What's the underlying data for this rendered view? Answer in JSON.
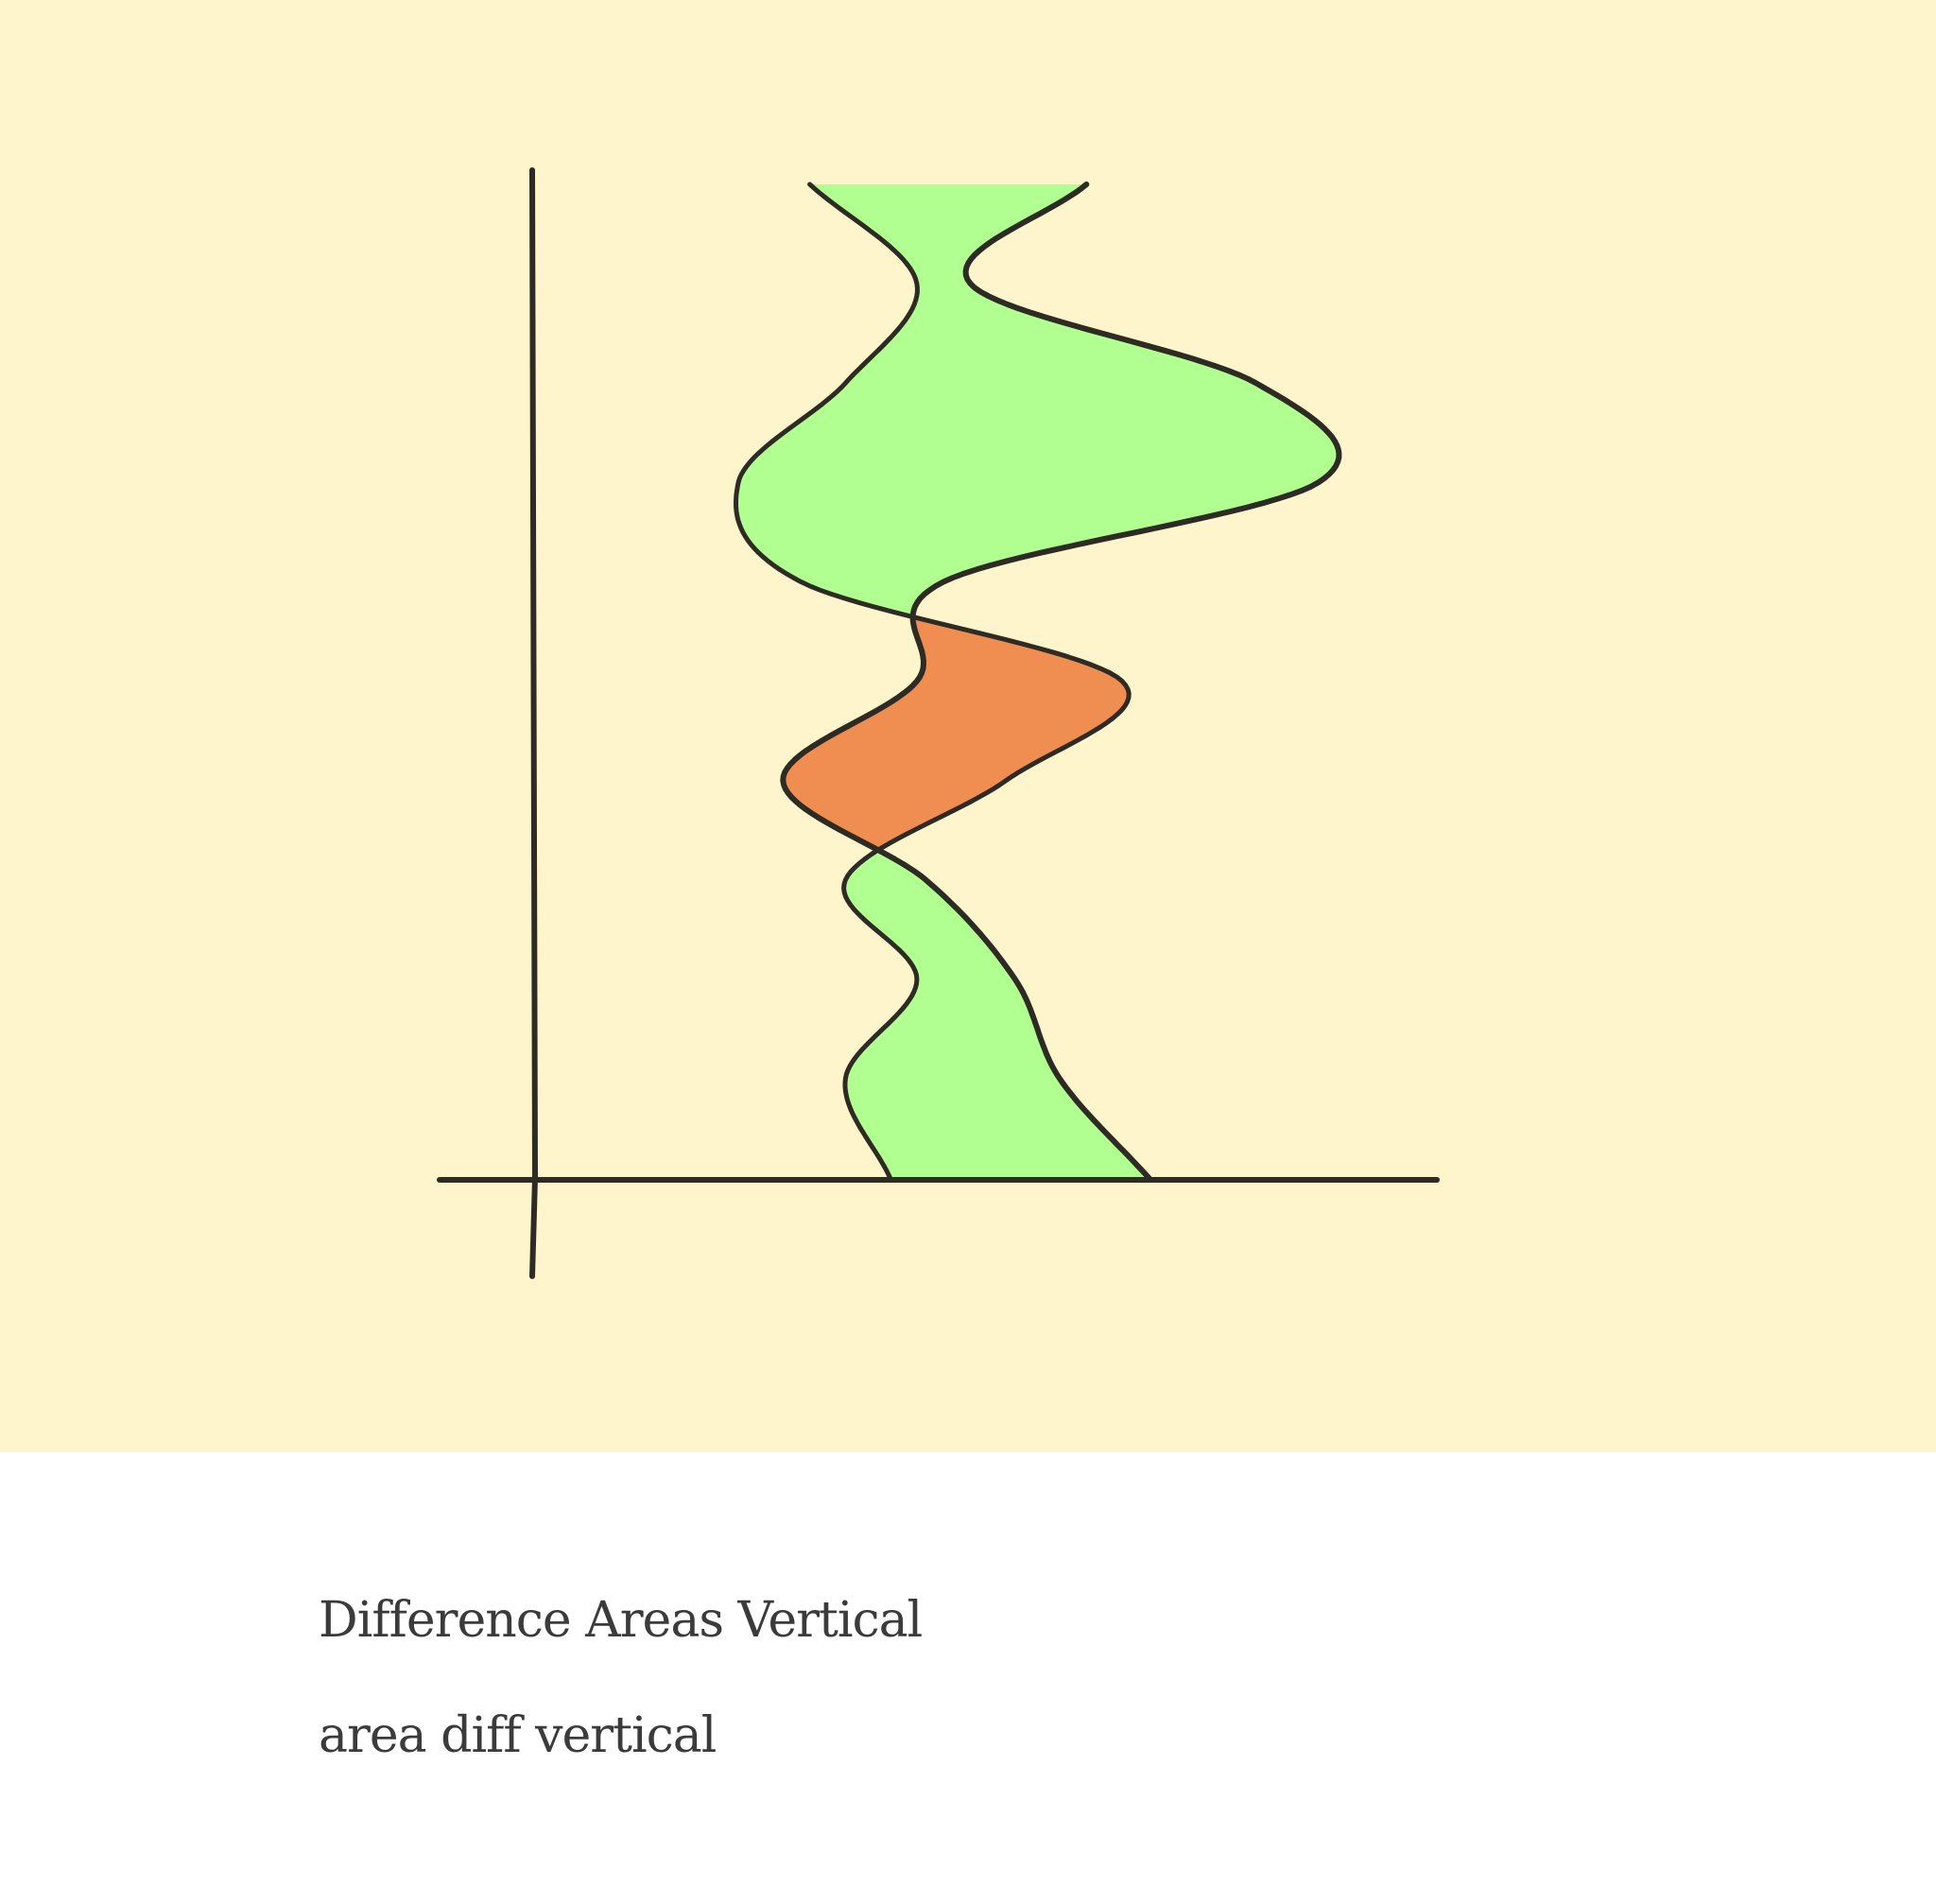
{
  "caption": {
    "title": "Difference Areas Vertical",
    "subtitle": "area diff vertical"
  },
  "colors": {
    "background": "#fef5cc",
    "positive_fill": "#b0ff90",
    "negative_fill": "#ef8e50",
    "stroke": "#2e2b24"
  },
  "chart_data": {
    "type": "area",
    "orientation": "vertical",
    "style": "hand-drawn difference area",
    "title": "",
    "xlabel": "",
    "ylabel": "",
    "grid": false,
    "legend": "none",
    "ylim": [
      0,
      10
    ],
    "xlim": [
      0,
      10
    ],
    "y": [
      0,
      1,
      2,
      3,
      4,
      5,
      6,
      7,
      8,
      9,
      10
    ],
    "series": [
      {
        "values": [
          4.0,
          3.5,
          4.3,
          3.5,
          5.3,
          6.6,
          3.0,
          2.3,
          3.5,
          4.3,
          3.1
        ]
      },
      {
        "values": [
          6.9,
          5.9,
          5.4,
          4.4,
          2.8,
          4.3,
          4.6,
          8.8,
          8.1,
          4.9,
          6.2
        ]
      }
    ],
    "difference_fill": {
      "series_b_greater": "#b0ff90",
      "series_a_greater": "#ef8e50"
    }
  }
}
